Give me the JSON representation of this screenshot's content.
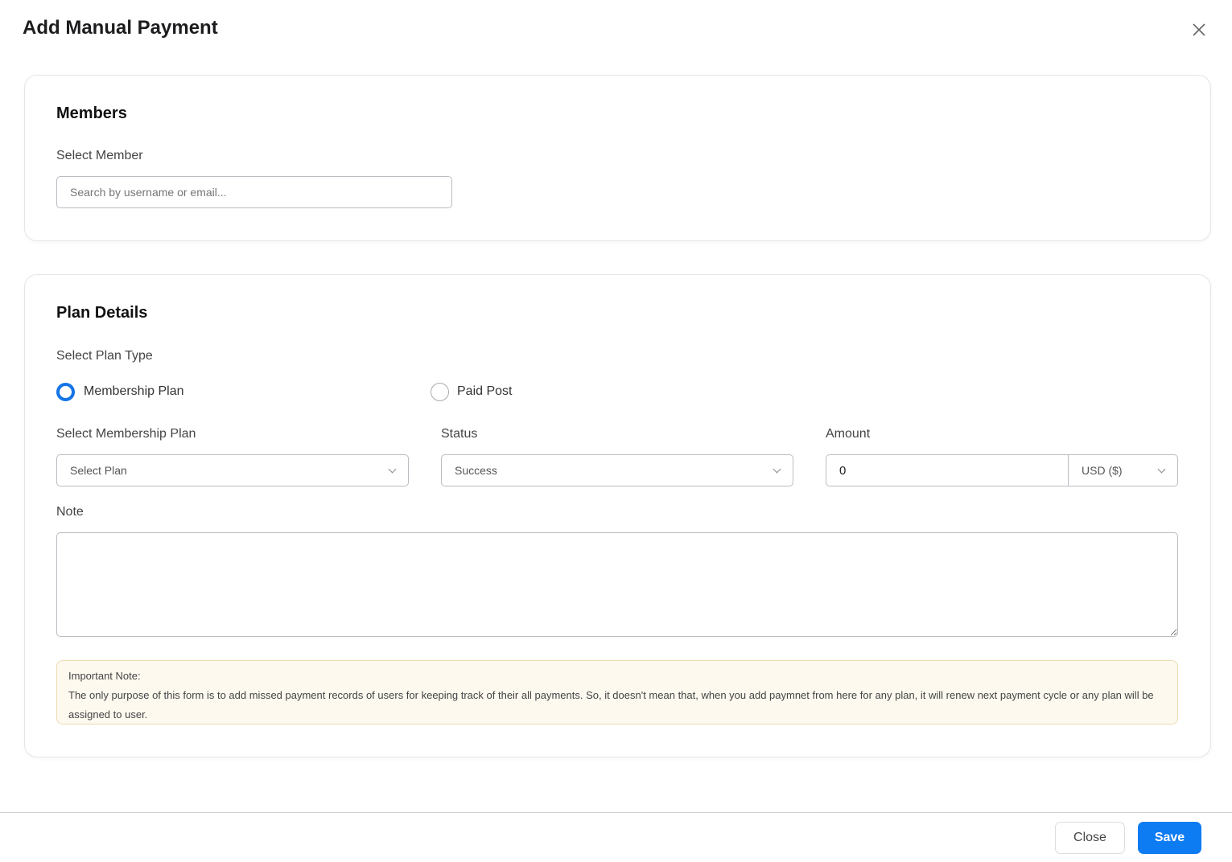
{
  "title": "Add Manual Payment",
  "members": {
    "heading": "Members",
    "select_label": "Select Member",
    "search_placeholder": "Search by username or email..."
  },
  "plan": {
    "heading": "Plan Details",
    "type_label": "Select Plan Type",
    "options": [
      {
        "label": "Membership Plan",
        "selected": true
      },
      {
        "label": "Paid Post",
        "selected": false
      }
    ],
    "plan_label": "Select Membership Plan",
    "plan_value": "Select Plan",
    "status_label": "Status",
    "status_value": "Success",
    "amount_label": "Amount",
    "amount_value": "0",
    "currency": "USD ($)",
    "note_label": "Note",
    "note_value": ""
  },
  "important": {
    "title": "Important Note:",
    "text": "The only purpose of this form is to add missed payment records of users for keeping track of their all payments. So, it doesn't mean that, when you add paymnet from here for any plan, it will renew next payment cycle or any plan will be assigned to user."
  },
  "footer": {
    "close": "Close",
    "save": "Save"
  },
  "colors": {
    "accent": "#0d7bf2"
  }
}
